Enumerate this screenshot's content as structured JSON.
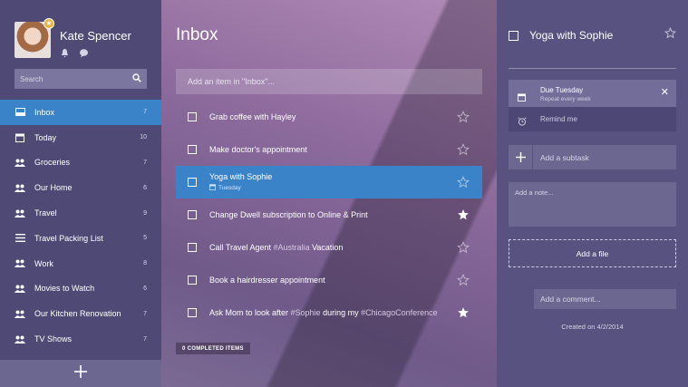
{
  "user": {
    "name": "Kate Spencer",
    "badge_icon": "star-badge-icon"
  },
  "sidebar": {
    "search_placeholder": "Search",
    "items": [
      {
        "label": "Inbox",
        "count": "7",
        "icon": "inbox-icon",
        "active": true
      },
      {
        "label": "Today",
        "count": "10",
        "icon": "calendar-icon"
      },
      {
        "label": "Groceries",
        "count": "7",
        "icon": "shared-users-icon"
      },
      {
        "label": "Our Home",
        "count": "6",
        "icon": "shared-users-icon"
      },
      {
        "label": "Travel",
        "count": "9",
        "icon": "shared-users-icon"
      },
      {
        "label": "Travel Packing List",
        "count": "5",
        "icon": "list-icon"
      },
      {
        "label": "Work",
        "count": "8",
        "icon": "shared-users-icon"
      },
      {
        "label": "Movies to Watch",
        "count": "6",
        "icon": "shared-users-icon"
      },
      {
        "label": "Our Kitchen Renovation",
        "count": "7",
        "icon": "shared-users-icon"
      },
      {
        "label": "TV Shows",
        "count": "7",
        "icon": "shared-users-icon"
      }
    ],
    "add_label": "+"
  },
  "main": {
    "title": "Inbox",
    "add_placeholder": "Add an item in \"Inbox\"...",
    "tasks": [
      {
        "parts": [
          {
            "t": "Grab coffee with Hayley"
          }
        ],
        "starred": false
      },
      {
        "parts": [
          {
            "t": "Make doctor's appointment"
          }
        ],
        "starred": false
      },
      {
        "parts": [
          {
            "t": "Yoga with Sophie"
          }
        ],
        "sub": "Tuesday",
        "starred": false,
        "selected": true
      },
      {
        "parts": [
          {
            "t": "Change Dwell subscription to Online & Print"
          }
        ],
        "starred": true
      },
      {
        "parts": [
          {
            "t": "Call Travel Agent "
          },
          {
            "t": "#Australia",
            "tag": true
          },
          {
            "t": " Vacation"
          }
        ],
        "starred": false
      },
      {
        "parts": [
          {
            "t": "Book a hairdresser appointment"
          }
        ],
        "starred": false
      },
      {
        "parts": [
          {
            "t": "Ask Mom to look after "
          },
          {
            "t": "#Sophie",
            "tag": true
          },
          {
            "t": " during my "
          },
          {
            "t": "#ChicagoConference",
            "tag": true
          }
        ],
        "starred": true
      }
    ],
    "completed_label": "0 COMPLETED ITEMS"
  },
  "detail": {
    "title": "Yoga with Sophie",
    "due_label": "Due Tuesday",
    "repeat_label": "Repeat every week",
    "remind_label": "Remind me",
    "subtask_placeholder": "Add a subtask",
    "note_placeholder": "Add a note...",
    "file_label": "Add a file",
    "comment_placeholder": "Add a comment...",
    "created_label": "Created on 4/2/2014"
  },
  "colors": {
    "accent": "#3b83c8",
    "sidebar": "#4f4a75",
    "detail": "#57527f"
  }
}
